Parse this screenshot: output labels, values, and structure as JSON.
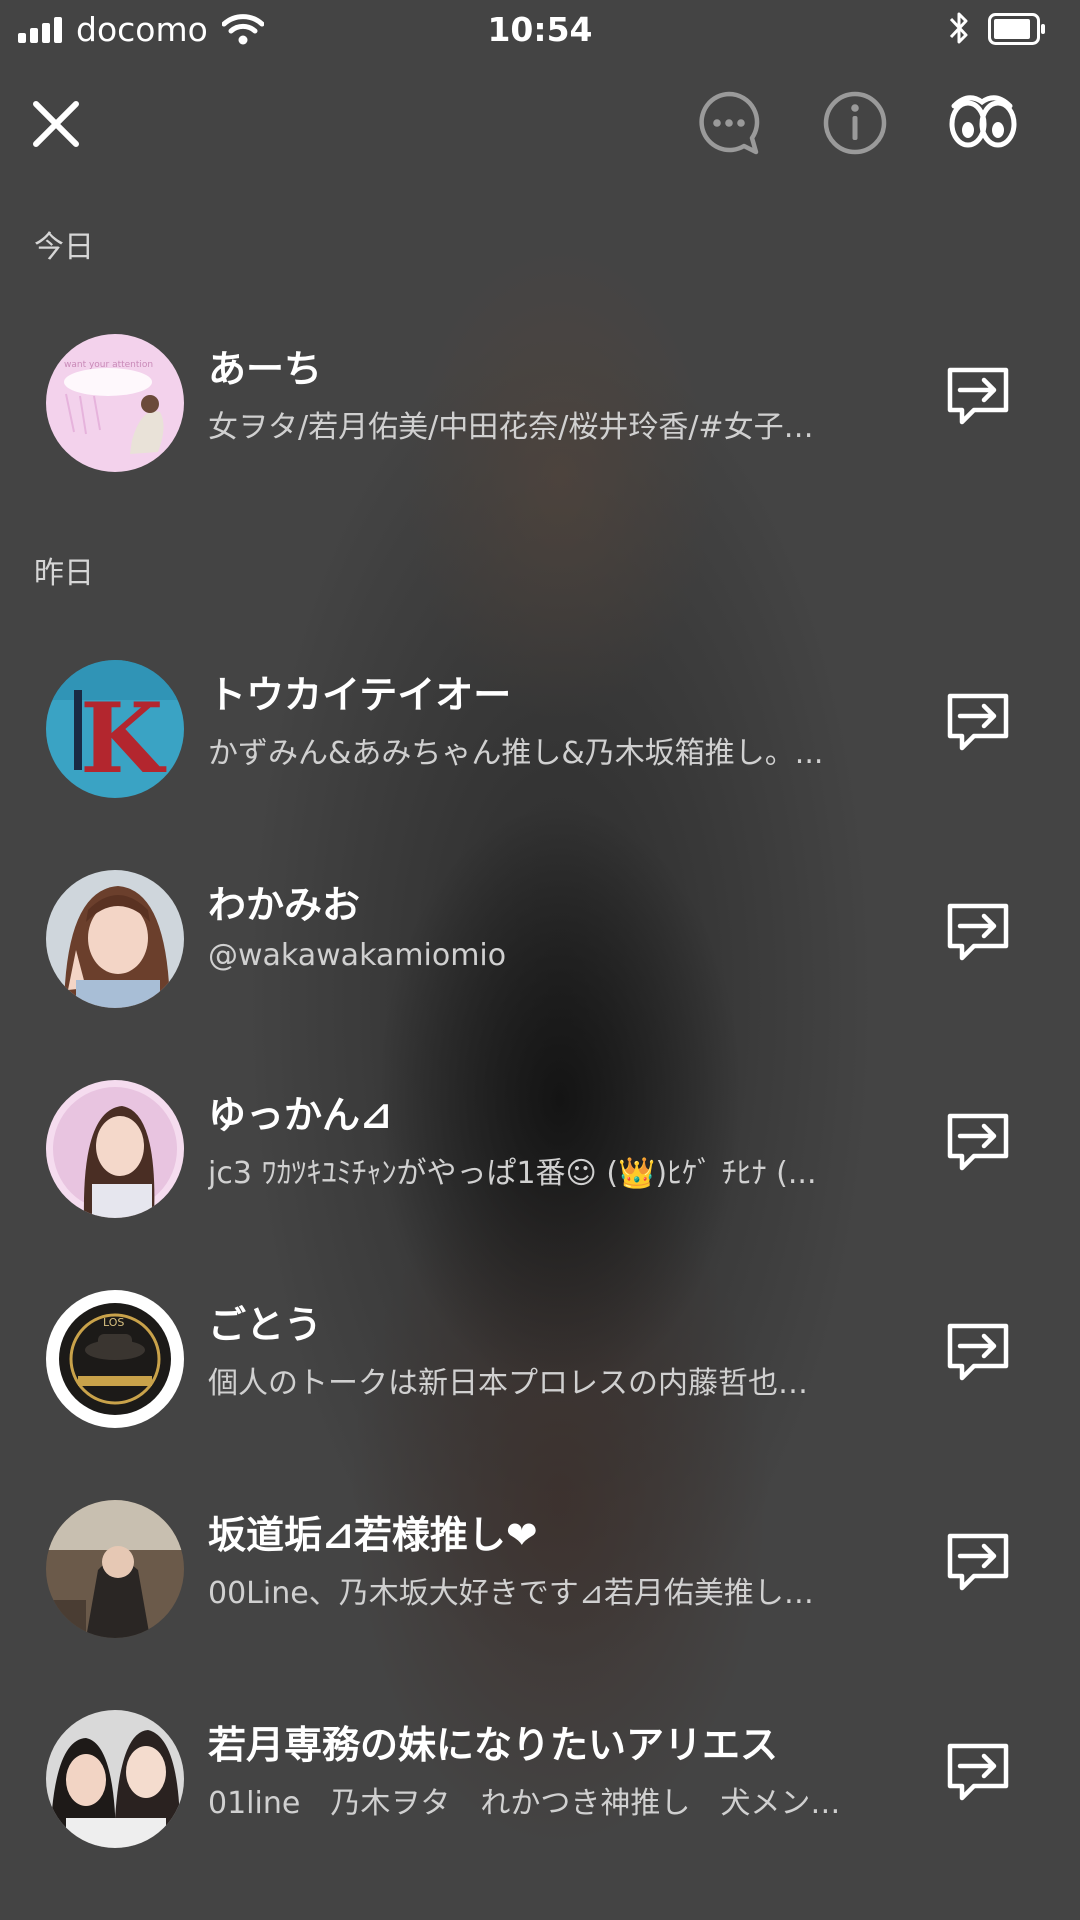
{
  "status_bar": {
    "carrier": "docomo",
    "time": "10:54"
  },
  "header": {
    "icons": [
      "close-icon",
      "chat-bubble-icon",
      "info-icon",
      "eyes-icon"
    ]
  },
  "sections": [
    {
      "label": "今日",
      "items": [
        {
          "name": "あーち",
          "subtitle": "女ヲタ/若月佑美/中田花奈/桜井玲香/#女子…",
          "avatar_text": "want your attention"
        }
      ]
    },
    {
      "label": "昨日",
      "items": [
        {
          "name": "トウカイテイオー",
          "subtitle": "かずみん&あみちゃん推し&乃木坂箱推し。...",
          "avatar_text": "K"
        },
        {
          "name": "わかみお",
          "subtitle": "@wakawakamiomio"
        },
        {
          "name": "ゆっかん⊿",
          "subtitle": "jc3 ﾜｶﾂｷﾕﾐﾁｬﾝがやっぱ1番☺ (👑)ﾋｹﾞ ﾁﾋﾅ (..."
        },
        {
          "name": "ごとう",
          "subtitle": "個人のトークは新日本プロレスの内藤哲也…",
          "avatar_text": "LOS"
        },
        {
          "name": "坂道垢⊿若様推し❤",
          "subtitle": "00Line、乃木坂大好きです⊿若月佑美推し…"
        },
        {
          "name": "若月専務の妹になりたいアリエス",
          "subtitle": "01line　乃木ヲタ　れかつき神推し　犬メン…"
        }
      ]
    }
  ]
}
